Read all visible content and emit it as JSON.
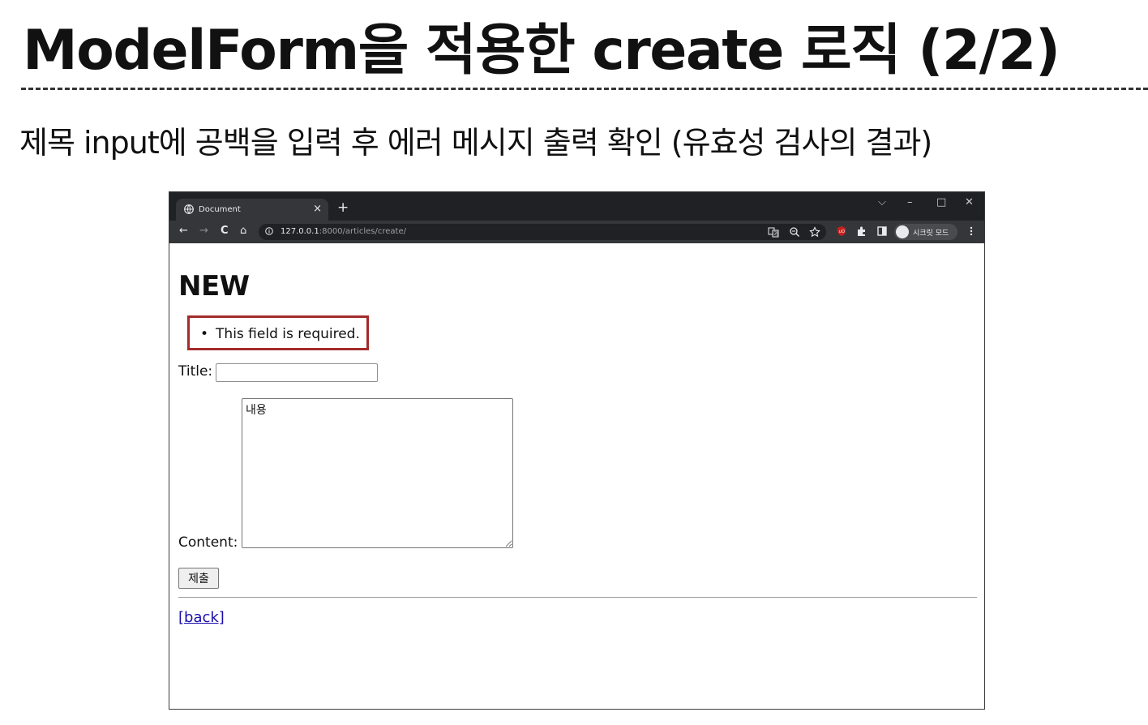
{
  "slide": {
    "title": "ModelForm을 적용한 create 로직 (2/2)",
    "subtitle": "제목 input에 공백을 입력 후 에러 메시지 출력 확인 (유효성 검사의 결과)"
  },
  "browser": {
    "tab": {
      "title": "Document",
      "close": "×",
      "favicon": "globe-icon"
    },
    "new_tab": "+",
    "window_controls": {
      "dropdown": "⌵",
      "minimize": "–",
      "maximize": "□",
      "close": "✕"
    },
    "nav": {
      "back": "←",
      "forward": "→",
      "reload": "C",
      "home": "⌂"
    },
    "address": {
      "host": "127.0.0.1",
      "path": ":8000/articles/create/"
    },
    "toolbar_icons": [
      "translate-icon",
      "zoom-icon",
      "star-icon",
      "ublock-icon",
      "extensions-icon",
      "sidepanel-icon",
      "menu-icon"
    ],
    "profile_label": "시크릿 모드"
  },
  "page": {
    "heading": "NEW",
    "errors": [
      "This field is required."
    ],
    "title_label": "Title:",
    "title_value": "",
    "content_label": "Content:",
    "content_value": "내용",
    "submit_label": "제출",
    "back_link": "[back]"
  },
  "colors": {
    "error_highlight": "#a32b2b",
    "link": "#1a0dab",
    "chrome_dark": "#202124",
    "chrome_toolbar": "#35363a"
  }
}
